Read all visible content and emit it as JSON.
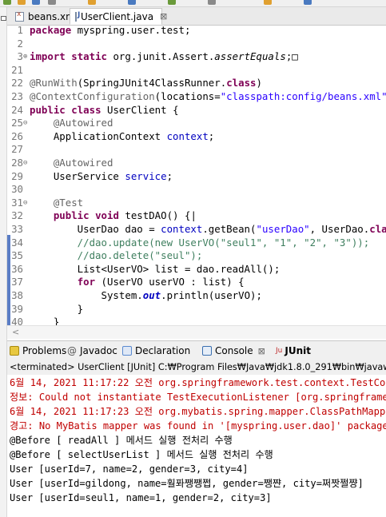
{
  "editor": {
    "tabs": [
      {
        "label": "beans.xml",
        "icon": "xml-file-icon"
      },
      {
        "label": "UserClient.java",
        "icon": "java-file-icon",
        "close": "⊠"
      }
    ],
    "lines": [
      {
        "n": "1",
        "fold": "",
        "code": [
          {
            "t": "package",
            "c": "kw"
          },
          {
            "t": " myspring.user.test;"
          }
        ]
      },
      {
        "n": "2",
        "fold": "",
        "code": []
      },
      {
        "n": "3",
        "fold": "⊕",
        "code": [
          {
            "t": "import",
            "c": "kw"
          },
          {
            "t": " "
          },
          {
            "t": "static",
            "c": "kw"
          },
          {
            "t": " org.junit.Assert."
          },
          {
            "t": "assertEquals",
            "c": "it"
          },
          {
            "t": ";□"
          }
        ]
      },
      {
        "n": "21",
        "fold": "",
        "code": []
      },
      {
        "n": "22",
        "fold": "",
        "code": [
          {
            "t": "@RunWith",
            "c": "ann"
          },
          {
            "t": "(SpringJUnit4ClassRunner."
          },
          {
            "t": "class",
            "c": "kw"
          },
          {
            "t": ")"
          }
        ]
      },
      {
        "n": "23",
        "fold": "",
        "code": [
          {
            "t": "@ContextConfiguration",
            "c": "ann"
          },
          {
            "t": "(locations="
          },
          {
            "t": "\"classpath:config/beans.xml\"",
            "c": "str"
          }
        ]
      },
      {
        "n": "24",
        "fold": "",
        "code": [
          {
            "t": "public",
            "c": "kw"
          },
          {
            "t": " "
          },
          {
            "t": "class",
            "c": "kw"
          },
          {
            "t": " UserClient {"
          }
        ]
      },
      {
        "n": "25",
        "fold": "⊖",
        "code": [
          {
            "t": "    "
          },
          {
            "t": "@Autowired",
            "c": "ann"
          }
        ]
      },
      {
        "n": "26",
        "fold": "",
        "code": [
          {
            "t": "    ApplicationContext "
          },
          {
            "t": "context",
            "c": "fld"
          },
          {
            "t": ";"
          }
        ]
      },
      {
        "n": "27",
        "fold": "",
        "code": []
      },
      {
        "n": "28",
        "fold": "⊖",
        "code": [
          {
            "t": "    "
          },
          {
            "t": "@Autowired",
            "c": "ann"
          }
        ]
      },
      {
        "n": "29",
        "fold": "",
        "code": [
          {
            "t": "    UserService "
          },
          {
            "t": "service",
            "c": "fld"
          },
          {
            "t": ";"
          }
        ]
      },
      {
        "n": "30",
        "fold": "",
        "code": []
      },
      {
        "n": "31",
        "fold": "⊖",
        "code": [
          {
            "t": "    "
          },
          {
            "t": "@Test",
            "c": "ann"
          }
        ]
      },
      {
        "n": "32",
        "fold": "",
        "code": [
          {
            "t": "    "
          },
          {
            "t": "public",
            "c": "kw"
          },
          {
            "t": " "
          },
          {
            "t": "void",
            "c": "kw"
          },
          {
            "t": " testDAO() {|"
          }
        ]
      },
      {
        "n": "33",
        "fold": "",
        "code": [
          {
            "t": "        UserDao dao = "
          },
          {
            "t": "context",
            "c": "fld"
          },
          {
            "t": ".getBean("
          },
          {
            "t": "\"userDao\"",
            "c": "str"
          },
          {
            "t": ", UserDao."
          },
          {
            "t": "cla",
            "c": "kw"
          }
        ]
      },
      {
        "n": "34",
        "fold": "",
        "code": [
          {
            "t": "        //dao.update(new UserVO(\"seul1\", \"1\", \"2\", \"3\"));",
            "c": "cm"
          }
        ]
      },
      {
        "n": "35",
        "fold": "",
        "code": [
          {
            "t": "        //dao.delete(\"seul\");",
            "c": "cm"
          }
        ]
      },
      {
        "n": "36",
        "fold": "",
        "code": [
          {
            "t": "        List<UserVO> list = dao.readAll();"
          }
        ]
      },
      {
        "n": "37",
        "fold": "",
        "code": [
          {
            "t": "        "
          },
          {
            "t": "for",
            "c": "kw"
          },
          {
            "t": " (UserVO userVO : list) {"
          }
        ]
      },
      {
        "n": "38",
        "fold": "",
        "code": [
          {
            "t": "            System."
          },
          {
            "t": "out",
            "c": "fld it kw"
          },
          {
            "t": ".println(userVO);"
          }
        ]
      },
      {
        "n": "39",
        "fold": "",
        "code": [
          {
            "t": "        }"
          }
        ]
      },
      {
        "n": "40",
        "fold": "",
        "code": [
          {
            "t": "    }"
          }
        ]
      },
      {
        "n": "41",
        "fold": "",
        "code": []
      }
    ],
    "scroll_arrow": "<"
  },
  "panel": {
    "tabs": [
      {
        "label": "Problems",
        "icon": "problems-icon",
        "color": "#c8a000"
      },
      {
        "label": "Javadoc",
        "icon": "javadoc-icon",
        "prefix": "@"
      },
      {
        "label": "Declaration",
        "icon": "declaration-icon",
        "color": "#5a8ad0"
      },
      {
        "label": "Console",
        "icon": "console-icon",
        "color": "#3a6fb0",
        "close": "⊠"
      },
      {
        "label": "JUnit",
        "icon": "junit-icon",
        "color": "#c03030",
        "badge": "Ju"
      }
    ],
    "status": "<terminated> UserClient [JUnit] C:₩Program Files₩Java₩jdk1.8.0_291₩bin₩javaw.exe",
    "console_lines": [
      {
        "text": "6월 14, 2021 11:17:22 오전 org.springframework.test.context.TestCor",
        "red": true
      },
      {
        "text": "정보: Could not instantiate TestExecutionListener [org.springframe",
        "red": true
      },
      {
        "text": "6월 14, 2021 11:17:23 오전 org.mybatis.spring.mapper.ClassPathMappe",
        "red": true
      },
      {
        "text": "경고: No MyBatis mapper was found in '[myspring.user.dao]' package",
        "red": true
      },
      {
        "text": "@Before [ readAll ] 메서드 실행 전처리 수행",
        "red": false
      },
      {
        "text": "@Before [ selectUserList ] 메서드 실행 전처리 수행",
        "red": false
      },
      {
        "text": "User [userId=7, name=2, gender=3, city=4]",
        "red": false
      },
      {
        "text": "User [userId=gildong, name=훨퐈쨍쨍쩝, gender=쨍쨘, city=쩌짯쩔쨩]",
        "red": false
      },
      {
        "text": "User [userId=seul1, name=1, gender=2, city=3]",
        "red": false
      }
    ]
  },
  "colors": {
    "keyword": "#7f0055",
    "annotation": "#646464",
    "string": "#2a00ff",
    "comment": "#3f7f5f",
    "field": "#0000c0",
    "error": "#c00000",
    "breakpoint_bar": "#5a7dc5"
  }
}
